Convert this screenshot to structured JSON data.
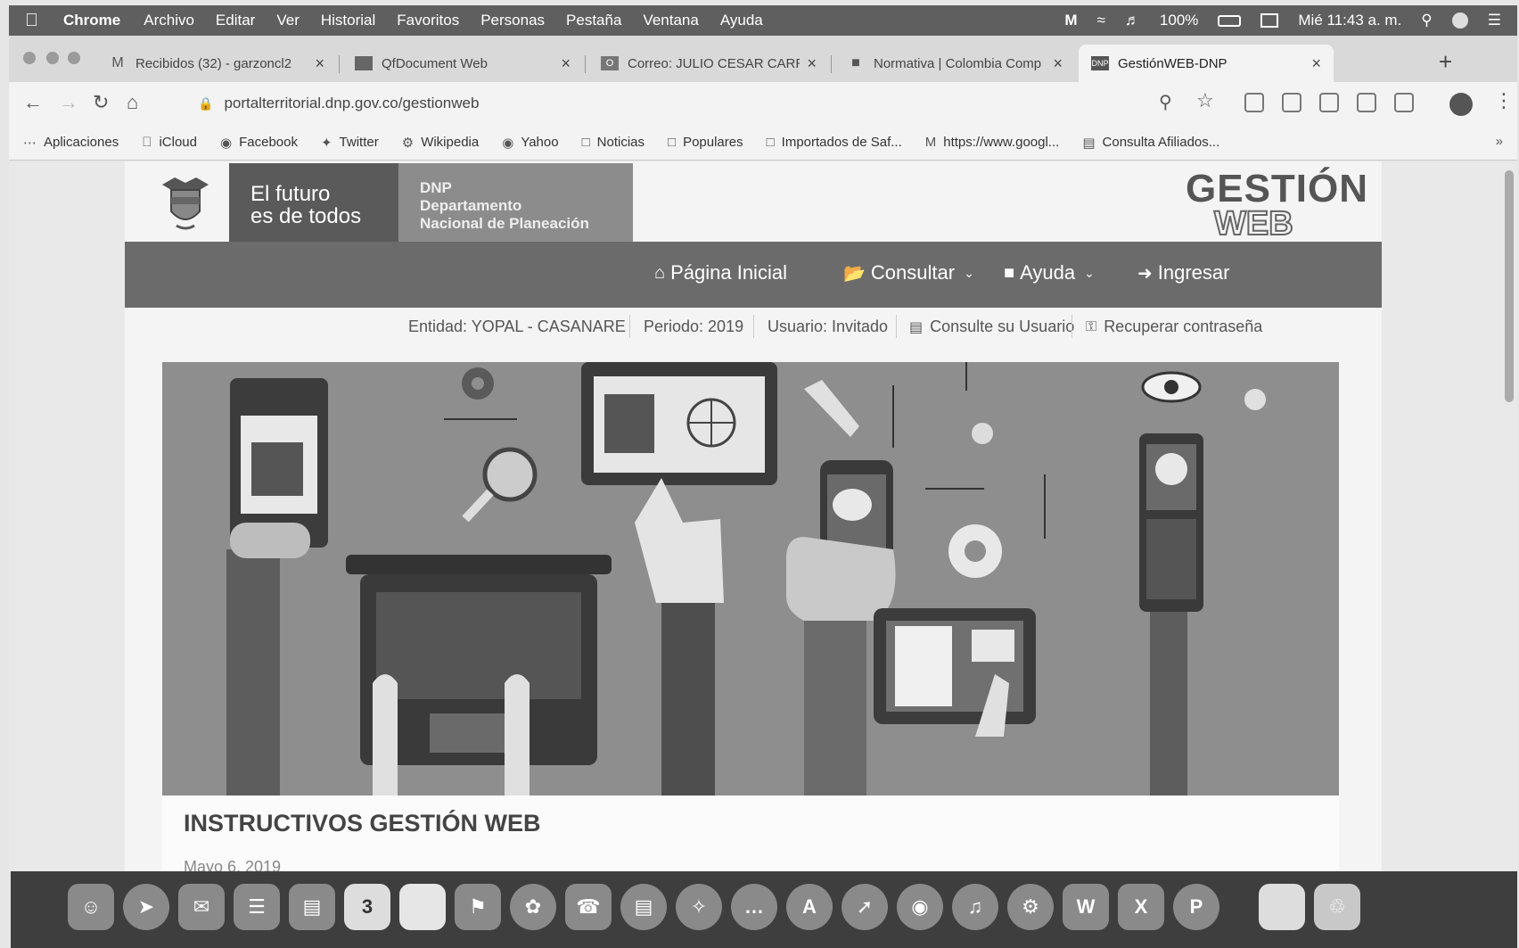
{
  "menubar": {
    "app_name": "Chrome",
    "items": [
      "Archivo",
      "Editar",
      "Ver",
      "Historial",
      "Favoritos",
      "Personas",
      "Pestaña",
      "Ventana",
      "Ayuda"
    ],
    "battery": "100%",
    "clock": "Mié 11:43 a. m."
  },
  "tabs": [
    {
      "title": "Recibidos (32) - garzoncl2",
      "icon": "gmail-icon",
      "active": false
    },
    {
      "title": "QfDocument Web",
      "icon": "document-icon",
      "active": false
    },
    {
      "title": "Correo: JULIO CESAR CARR",
      "icon": "outlook-icon",
      "active": false
    },
    {
      "title": "Normativa | Colombia Comp",
      "icon": "flag-icon",
      "active": false
    },
    {
      "title": "GestiónWEB-DNP",
      "icon": "dnp-icon",
      "active": true
    }
  ],
  "address": {
    "url": "portalterritorial.dnp.gov.co/gestionweb"
  },
  "bookmarks": [
    {
      "label": "Aplicaciones",
      "icon": "apps-grid-icon"
    },
    {
      "label": "iCloud",
      "icon": "apple-icon"
    },
    {
      "label": "Facebook",
      "icon": "facebook-icon"
    },
    {
      "label": "Twitter",
      "icon": "twitter-icon"
    },
    {
      "label": "Wikipedia",
      "icon": "wikipedia-icon"
    },
    {
      "label": "Yahoo",
      "icon": "globe-icon"
    },
    {
      "label": "Noticias",
      "icon": "folder-icon"
    },
    {
      "label": "Populares",
      "icon": "folder-icon"
    },
    {
      "label": "Importados de Saf...",
      "icon": "folder-icon"
    },
    {
      "label": "https://www.googl...",
      "icon": "gmail-icon"
    },
    {
      "label": "Consulta Afiliados...",
      "icon": "bank-icon"
    }
  ],
  "site": {
    "slogan_line1": "El futuro",
    "slogan_line2": "es de todos",
    "dnp_line1": "DNP",
    "dnp_line2": "Departamento",
    "dnp_line3": "Nacional de Planeación",
    "brand_line1": "GESTIÓN",
    "brand_line2": "WEB"
  },
  "nav": {
    "home": "Página Inicial",
    "consult": "Consultar",
    "help": "Ayuda",
    "login": "Ingresar"
  },
  "info": {
    "entity": "Entidad: YOPAL - CASANARE",
    "period": "Periodo: 2019",
    "user": "Usuario: Invitado",
    "consult_user": "Consulte su Usuario",
    "recover": "Recuperar contraseña"
  },
  "article": {
    "title": "INSTRUCTIVOS GESTIÓN WEB",
    "date": "Mayo 6, 2019"
  },
  "dock": {
    "calendar_day": "3",
    "word": "W",
    "excel": "X",
    "powerpoint": "P"
  }
}
